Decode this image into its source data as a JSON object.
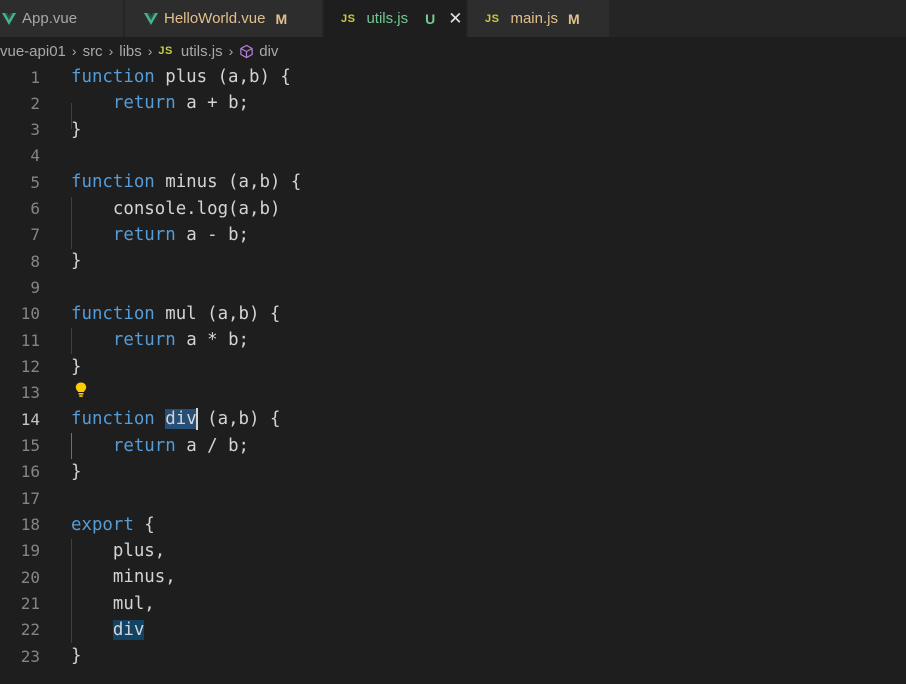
{
  "tabs": [
    {
      "label": "App.vue",
      "icon": "vue-icon",
      "status": "",
      "active": false
    },
    {
      "label": "HelloWorld.vue",
      "icon": "vue-icon",
      "status": "M",
      "active": false
    },
    {
      "label": "utils.js",
      "icon": "js-icon",
      "icon_text": "JS",
      "status": "U",
      "active": true
    },
    {
      "label": "main.js",
      "icon": "js-icon",
      "icon_text": "JS",
      "status": "M",
      "active": false
    }
  ],
  "colors": {
    "untracked": "#73c991",
    "modified": "#e2c08d",
    "keyword": "#569cd6",
    "vue": "#41b883"
  },
  "breadcrumb": {
    "items": [
      "vue-api01",
      "src",
      "libs",
      "utils.js",
      "div"
    ],
    "file_icon_text": "JS"
  },
  "editor": {
    "current_line": 14,
    "lines": [
      {
        "n": "1",
        "kw": "function",
        "rest": " plus (a,b) {"
      },
      {
        "n": "2",
        "indent": "    ",
        "kw": "return",
        "rest": " a + b;"
      },
      {
        "n": "3",
        "rest": "}"
      },
      {
        "n": "4",
        "rest": ""
      },
      {
        "n": "5",
        "kw": "function",
        "rest": " minus (a,b) {"
      },
      {
        "n": "6",
        "indent": "    ",
        "rest": "console.log(a,b)"
      },
      {
        "n": "7",
        "indent": "    ",
        "kw": "return",
        "rest": " a - b;"
      },
      {
        "n": "8",
        "rest": "}"
      },
      {
        "n": "9",
        "rest": ""
      },
      {
        "n": "10",
        "kw": "function",
        "rest": " mul (a,b) {"
      },
      {
        "n": "11",
        "indent": "    ",
        "kw": "return",
        "rest": " a * b;"
      },
      {
        "n": "12",
        "rest": "}"
      },
      {
        "n": "13",
        "rest": ""
      },
      {
        "n": "14",
        "kw": "function",
        "pre": " ",
        "hl": "div",
        "rest": " (a,b) {"
      },
      {
        "n": "15",
        "indent": "    ",
        "kw": "return",
        "rest": " a / b;"
      },
      {
        "n": "16",
        "rest": "}"
      },
      {
        "n": "17",
        "rest": ""
      },
      {
        "n": "18",
        "kw": "export",
        "rest": " {"
      },
      {
        "n": "19",
        "indent": "    ",
        "rest": "plus,"
      },
      {
        "n": "20",
        "indent": "    ",
        "rest": "minus,"
      },
      {
        "n": "21",
        "indent": "    ",
        "rest": "mul,"
      },
      {
        "n": "22",
        "indent": "    ",
        "hl2": "div",
        "rest": ""
      },
      {
        "n": "23",
        "rest": "}"
      }
    ]
  }
}
